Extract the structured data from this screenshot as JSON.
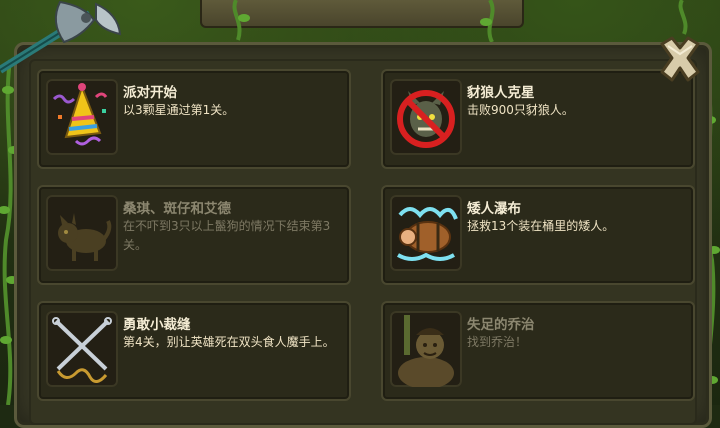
{
  "achievements": [
    {
      "title": "派对开始",
      "desc": "以3颗星通过第1关。",
      "icon": "party-hat-icon",
      "unlocked": true
    },
    {
      "title": "豺狼人克星",
      "desc": "击败900只豺狼人。",
      "icon": "no-gnoll-icon",
      "unlocked": true
    },
    {
      "title": "桑琪、斑仔和艾德",
      "desc": "在不吓到3只以上鬣狗的情况下结束第3关。",
      "icon": "hyena-icon",
      "unlocked": false
    },
    {
      "title": "矮人瀑布",
      "desc": "拯救13个装在桶里的矮人。",
      "icon": "dwarf-barrel-icon",
      "unlocked": true
    },
    {
      "title": "勇敢小裁缝",
      "desc": "第4关，别让英雄死在双头食人魔手上。",
      "icon": "crossed-needles-icon",
      "unlocked": true
    },
    {
      "title": "失足的乔治",
      "desc": "找到乔治！",
      "icon": "george-icon",
      "unlocked": false
    }
  ],
  "colors": {
    "panel": "#3a3a27",
    "card": "#2b2a1a",
    "title": "#f4ecd4",
    "locked_text": "#8c8770"
  }
}
